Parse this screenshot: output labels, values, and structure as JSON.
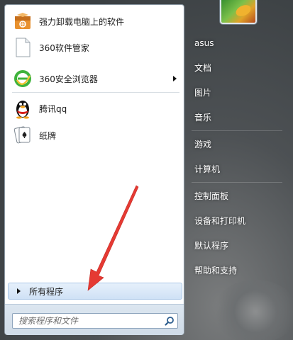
{
  "programs": [
    {
      "label": "强力卸载电脑上的软件",
      "icon": "uninstaller-box-icon",
      "has_submenu": false
    },
    {
      "label": "360软件管家",
      "icon": "document-icon",
      "has_submenu": false
    },
    {
      "label": "360安全浏览器",
      "icon": "360-browser-icon",
      "has_submenu": true
    },
    {
      "label": "腾讯qq",
      "icon": "qq-penguin-icon",
      "has_submenu": false
    },
    {
      "label": "纸牌",
      "icon": "solitaire-cards-icon",
      "has_submenu": false
    }
  ],
  "all_programs": {
    "label": "所有程序"
  },
  "search": {
    "placeholder": "搜索程序和文件"
  },
  "right_pane": {
    "items": [
      "asus",
      "文档",
      "图片",
      "音乐",
      "游戏",
      "计算机",
      "控制面板",
      "设备和打印机",
      "默认程序",
      "帮助和支持"
    ]
  },
  "colors": {
    "annotation_arrow": "#e53a33",
    "all_programs_bg": "#d6e6f7",
    "right_text": "#ffffff"
  }
}
